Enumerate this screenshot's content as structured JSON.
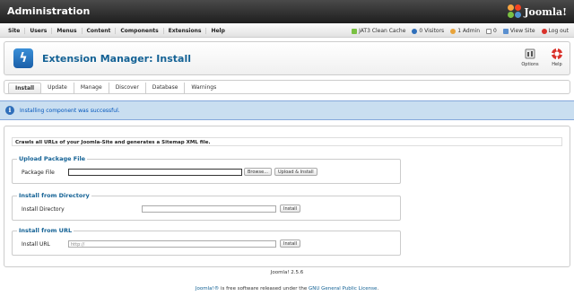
{
  "header": {
    "title": "Administration",
    "logo_text": "Joomla!"
  },
  "menu": {
    "items": [
      "Site",
      "Users",
      "Menus",
      "Content",
      "Components",
      "Extensions",
      "Help"
    ],
    "status": {
      "cache": "JAT3 Clean Cache",
      "visitors": "0 Visitors",
      "admins": "1 Admin",
      "messages": "0",
      "view_site": "View Site",
      "logout": "Log out"
    }
  },
  "toolbar": {
    "title": "Extension Manager: Install",
    "options_label": "Options",
    "help_label": "Help"
  },
  "tabs": [
    "Install",
    "Update",
    "Manage",
    "Discover",
    "Database",
    "Warnings"
  ],
  "message": {
    "text": "Installing component was successful."
  },
  "sitemap_note": "Crawls all URLs of your Joomla-Site and generates a Sitemap XML file.",
  "upload": {
    "legend": "Upload Package File",
    "label": "Package File",
    "browse_label": "Browse...",
    "button_label": "Upload & Install"
  },
  "directory": {
    "legend": "Install from Directory",
    "label": "Install Directory",
    "value": "",
    "button_label": "Install"
  },
  "url": {
    "legend": "Install from URL",
    "label": "Install URL",
    "value": "http://",
    "button_label": "Install"
  },
  "footer": {
    "version": "Joomla! 2.5.6",
    "license_link": "Joomla!®",
    "license_text": " is free software released under the ",
    "license_name": "GNU General Public License",
    "license_end": "."
  },
  "colors": {
    "accent": "#146295",
    "message_bg": "#c9def0",
    "header_bg": "#2b2b2b"
  }
}
